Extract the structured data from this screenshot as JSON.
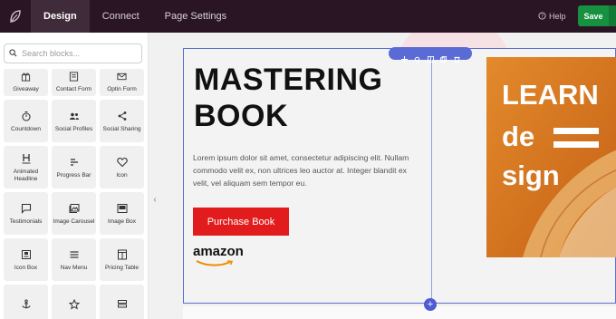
{
  "topbar": {
    "tabs": [
      {
        "label": "Design",
        "active": true
      },
      {
        "label": "Connect",
        "active": false
      },
      {
        "label": "Page Settings",
        "active": false
      }
    ],
    "help_label": "Help",
    "save_label": "Save"
  },
  "sidebar": {
    "search_placeholder": "Search blocks...",
    "blocks": [
      {
        "label": "Giveaway",
        "icon": "gift-icon"
      },
      {
        "label": "Contact Form",
        "icon": "contact-form-icon"
      },
      {
        "label": "Optin Form",
        "icon": "envelope-icon"
      },
      {
        "label": "Countdown",
        "icon": "stopwatch-icon"
      },
      {
        "label": "Social Profiles",
        "icon": "people-icon"
      },
      {
        "label": "Social Sharing",
        "icon": "share-icon"
      },
      {
        "label": "Animated Headline",
        "icon": "heading-icon"
      },
      {
        "label": "Progress Bar",
        "icon": "progress-bar-icon"
      },
      {
        "label": "Icon",
        "icon": "heart-icon"
      },
      {
        "label": "Testimonials",
        "icon": "speech-bubble-icon"
      },
      {
        "label": "Image Carousel",
        "icon": "image-carousel-icon"
      },
      {
        "label": "Image Box",
        "icon": "image-box-icon"
      },
      {
        "label": "Icon Box",
        "icon": "icon-box-icon"
      },
      {
        "label": "Nav Menu",
        "icon": "hamburger-menu-icon"
      },
      {
        "label": "Pricing Table",
        "icon": "pricing-table-icon"
      },
      {
        "label": "",
        "icon": "anchor-icon"
      },
      {
        "label": "",
        "icon": "star-icon"
      },
      {
        "label": "",
        "icon": "stacked-rows-icon"
      }
    ]
  },
  "canvas": {
    "headline_line1": "MASTERING",
    "headline_line2": "BOOK",
    "body": "Lorem ipsum dolor sit amet, consectetur adipiscing elit. Nullam commodo velit ex, non ultrices leo auctor at. Integer blandit ex velit, vel aliquam sem tempor eu.",
    "cta_label": "Purchase Book",
    "amazon_logo_text": "amazon",
    "book_cover": {
      "line1": "LEARN",
      "line2": "de",
      "line3": "sign"
    }
  },
  "colors": {
    "topbar_bg": "#2a1525",
    "save_green": "#15913f",
    "cta_red": "#e21c1c",
    "selection_blue": "#5b6bd6",
    "book_orange": "#d9751f"
  }
}
